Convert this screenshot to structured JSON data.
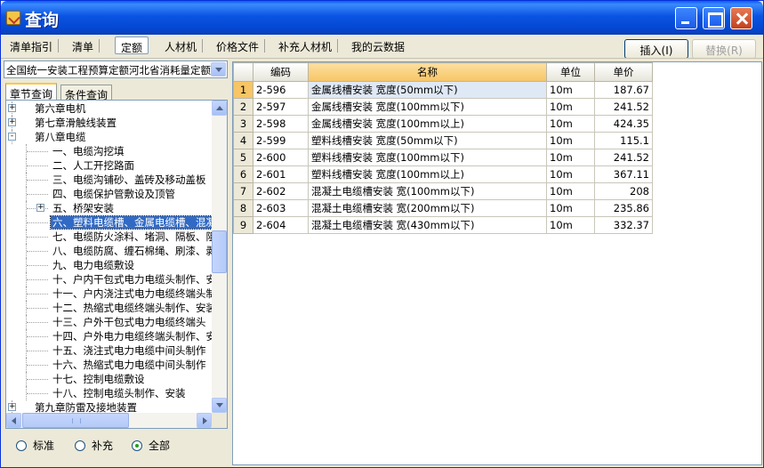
{
  "window": {
    "title": "查询"
  },
  "toolbar": {
    "tabs": [
      "清单指引",
      "清单",
      "定额",
      "人材机",
      "价格文件",
      "补充人材机",
      "我的云数据"
    ],
    "active_tab": "定额",
    "insert_label": "插入(I)",
    "replace_label": "替换(R)"
  },
  "left": {
    "combo_value": "全国统一安装工程预算定额河北省消耗量定额",
    "subtabs": [
      "章节查询",
      "条件查询"
    ],
    "tree": [
      {
        "label": "第六章电机",
        "level": 0,
        "expander": "+"
      },
      {
        "label": "第七章滑触线装置",
        "level": 0,
        "expander": "+"
      },
      {
        "label": "第八章电缆",
        "level": 0,
        "expander": "-"
      },
      {
        "label": "一、电缆沟挖填",
        "level": 1
      },
      {
        "label": "二、人工开挖路面",
        "level": 1
      },
      {
        "label": "三、电缆沟铺砂、盖砖及移动盖板",
        "level": 1
      },
      {
        "label": "四、电缆保护管敷设及顶管",
        "level": 1
      },
      {
        "label": "五、桥架安装",
        "level": 1,
        "expander": "+"
      },
      {
        "label": "六、塑料电缆槽、金属电缆槽、混凝土电缆槽安装",
        "level": 1,
        "selected": true
      },
      {
        "label": "七、电缆防火涂料、堵洞、隔板、阻燃槽盒安装",
        "level": 1
      },
      {
        "label": "八、电缆防腐、缠石棉绳、刷漆、剥皮",
        "level": 1
      },
      {
        "label": "九、电力电缆敷设",
        "level": 1
      },
      {
        "label": "十、户内干包式电力电缆头制作、安装",
        "level": 1
      },
      {
        "label": "十一、户内浇注式电力电缆终端头制作",
        "level": 1
      },
      {
        "label": "十二、热缩式电缆终端头制作、安装",
        "level": 1
      },
      {
        "label": "十三、户外干包式电力电缆终端头",
        "level": 1
      },
      {
        "label": "十四、户外电力电缆终端头制作、安装",
        "level": 1
      },
      {
        "label": "十五、浇注式电力电缆中间头制作",
        "level": 1
      },
      {
        "label": "十六、热缩式电力电缆中间头制作",
        "level": 1
      },
      {
        "label": "十七、控制电缆敷设",
        "level": 1
      },
      {
        "label": "十八、控制电缆头制作、安装",
        "level": 1
      },
      {
        "label": "第九章防雷及接地装置",
        "level": 0,
        "expander": "+"
      }
    ],
    "radios": [
      {
        "label": "标准",
        "checked": false
      },
      {
        "label": "补充",
        "checked": false
      },
      {
        "label": "全部",
        "checked": true
      }
    ]
  },
  "grid": {
    "columns": [
      "编码",
      "名称",
      "单位",
      "单价"
    ],
    "rows": [
      {
        "no": "1",
        "code": "2-596",
        "name": "金属线槽安装 宽度(50mm以下)",
        "unit": "10m",
        "price": "187.67"
      },
      {
        "no": "2",
        "code": "2-597",
        "name": "金属线槽安装 宽度(100mm以下)",
        "unit": "10m",
        "price": "241.52"
      },
      {
        "no": "3",
        "code": "2-598",
        "name": "金属线槽安装 宽度(100mm以上)",
        "unit": "10m",
        "price": "424.35"
      },
      {
        "no": "4",
        "code": "2-599",
        "name": "塑料线槽安装 宽度(50mm以下)",
        "unit": "10m",
        "price": "115.1"
      },
      {
        "no": "5",
        "code": "2-600",
        "name": "塑料线槽安装 宽度(100mm以下)",
        "unit": "10m",
        "price": "241.52"
      },
      {
        "no": "6",
        "code": "2-601",
        "name": "塑料线槽安装 宽度(100mm以上)",
        "unit": "10m",
        "price": "367.11"
      },
      {
        "no": "7",
        "code": "2-602",
        "name": "混凝土电缆槽安装 宽(100mm以下)",
        "unit": "10m",
        "price": "208"
      },
      {
        "no": "8",
        "code": "2-603",
        "name": "混凝土电缆槽安装 宽(200mm以下)",
        "unit": "10m",
        "price": "235.86"
      },
      {
        "no": "9",
        "code": "2-604",
        "name": "混凝土电缆槽安装 宽(430mm以下)",
        "unit": "10m",
        "price": "332.37"
      }
    ]
  }
}
